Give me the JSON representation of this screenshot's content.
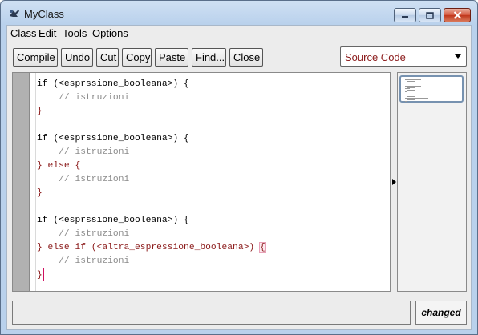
{
  "window": {
    "title": "MyClass"
  },
  "menu": [
    "Class",
    "Edit",
    "Tools",
    "Options"
  ],
  "toolbar": {
    "compile": "Compile",
    "undo": "Undo",
    "cut": "Cut",
    "copy": "Copy",
    "paste": "Paste",
    "find": "Find...",
    "close": "Close"
  },
  "view_select": {
    "value": "Source Code"
  },
  "editor": {
    "lines": [
      "if (<esprssione_booleana>) {",
      "    // istruzioni",
      "}",
      "",
      "if (<esprssione_booleana>) {",
      "    // istruzioni",
      "} else {",
      "    // istruzioni",
      "}",
      "",
      "if (<esprssione_booleana>) {",
      "    // istruzioni",
      "} else if (<altra_espressione_booleana>) {",
      "    // istruzioni",
      "}"
    ]
  },
  "status": {
    "message": "",
    "state": "changed"
  },
  "colors": {
    "keyword": "#8b1a1a",
    "comment": "#8b8b8b",
    "caret": "#d01060"
  },
  "icons": [
    "app-icon",
    "minimize-icon",
    "maximize-icon",
    "close-icon",
    "dropdown-arrow-icon",
    "split-arrow-icon"
  ]
}
